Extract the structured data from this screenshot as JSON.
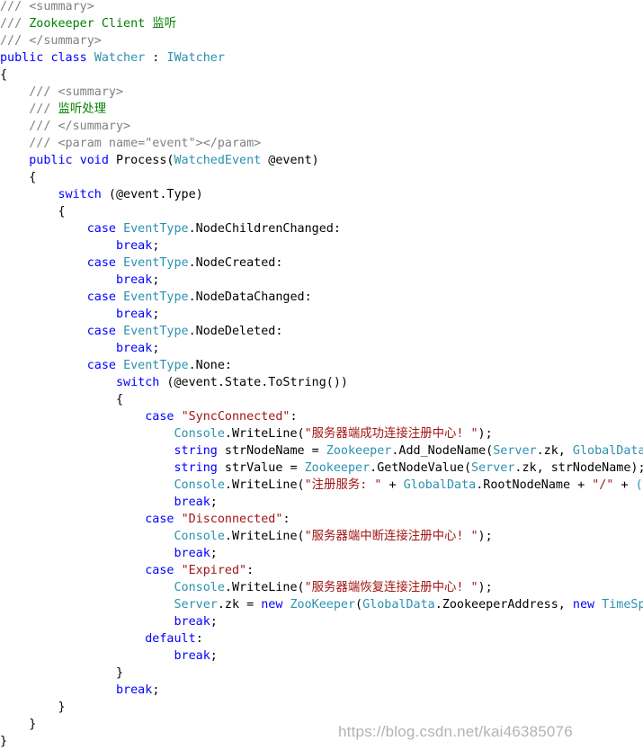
{
  "colors": {
    "plain": "#000000",
    "keyword": "#0000ff",
    "type": "#2b91af",
    "string": "#a31515",
    "comment": "#008000",
    "doc": "#808080",
    "background": "#ffffff"
  },
  "lines": [
    [
      [
        "doc",
        "/// <summary>"
      ]
    ],
    [
      [
        "doc",
        "/// "
      ],
      [
        "comment",
        "Zookeeper Client 监听"
      ]
    ],
    [
      [
        "doc",
        "/// </summary>"
      ]
    ],
    [
      [
        "keyword",
        "public"
      ],
      [
        "plain",
        " "
      ],
      [
        "keyword",
        "class"
      ],
      [
        "plain",
        " "
      ],
      [
        "type",
        "Watcher"
      ],
      [
        "plain",
        " : "
      ],
      [
        "type",
        "IWatcher"
      ]
    ],
    [
      [
        "plain",
        "{"
      ]
    ],
    [
      [
        "plain",
        "    "
      ],
      [
        "doc",
        "/// <summary>"
      ]
    ],
    [
      [
        "plain",
        "    "
      ],
      [
        "doc",
        "/// "
      ],
      [
        "comment",
        "监听处理"
      ]
    ],
    [
      [
        "plain",
        "    "
      ],
      [
        "doc",
        "/// </summary>"
      ]
    ],
    [
      [
        "plain",
        "    "
      ],
      [
        "doc",
        "/// <param name=\"event\"></param>"
      ]
    ],
    [
      [
        "plain",
        "    "
      ],
      [
        "keyword",
        "public"
      ],
      [
        "plain",
        " "
      ],
      [
        "keyword",
        "void"
      ],
      [
        "plain",
        " Process("
      ],
      [
        "type",
        "WatchedEvent"
      ],
      [
        "plain",
        " @event)"
      ]
    ],
    [
      [
        "plain",
        "    {"
      ]
    ],
    [
      [
        "plain",
        "        "
      ],
      [
        "keyword",
        "switch"
      ],
      [
        "plain",
        " (@event.Type)"
      ]
    ],
    [
      [
        "plain",
        "        {"
      ]
    ],
    [
      [
        "plain",
        "            "
      ],
      [
        "keyword",
        "case"
      ],
      [
        "plain",
        " "
      ],
      [
        "type",
        "EventType"
      ],
      [
        "plain",
        ".NodeChildrenChanged:"
      ]
    ],
    [
      [
        "plain",
        "                "
      ],
      [
        "keyword",
        "break"
      ],
      [
        "plain",
        ";"
      ]
    ],
    [
      [
        "plain",
        "            "
      ],
      [
        "keyword",
        "case"
      ],
      [
        "plain",
        " "
      ],
      [
        "type",
        "EventType"
      ],
      [
        "plain",
        ".NodeCreated:"
      ]
    ],
    [
      [
        "plain",
        "                "
      ],
      [
        "keyword",
        "break"
      ],
      [
        "plain",
        ";"
      ]
    ],
    [
      [
        "plain",
        "            "
      ],
      [
        "keyword",
        "case"
      ],
      [
        "plain",
        " "
      ],
      [
        "type",
        "EventType"
      ],
      [
        "plain",
        ".NodeDataChanged:"
      ]
    ],
    [
      [
        "plain",
        "                "
      ],
      [
        "keyword",
        "break"
      ],
      [
        "plain",
        ";"
      ]
    ],
    [
      [
        "plain",
        "            "
      ],
      [
        "keyword",
        "case"
      ],
      [
        "plain",
        " "
      ],
      [
        "type",
        "EventType"
      ],
      [
        "plain",
        ".NodeDeleted:"
      ]
    ],
    [
      [
        "plain",
        "                "
      ],
      [
        "keyword",
        "break"
      ],
      [
        "plain",
        ";"
      ]
    ],
    [
      [
        "plain",
        "            "
      ],
      [
        "keyword",
        "case"
      ],
      [
        "plain",
        " "
      ],
      [
        "type",
        "EventType"
      ],
      [
        "plain",
        ".None:"
      ]
    ],
    [
      [
        "plain",
        "                "
      ],
      [
        "keyword",
        "switch"
      ],
      [
        "plain",
        " (@event.State.ToString())"
      ]
    ],
    [
      [
        "plain",
        "                {"
      ]
    ],
    [
      [
        "plain",
        "                    "
      ],
      [
        "keyword",
        "case"
      ],
      [
        "plain",
        " "
      ],
      [
        "string",
        "\"SyncConnected\""
      ],
      [
        "plain",
        ":"
      ]
    ],
    [
      [
        "plain",
        "                        "
      ],
      [
        "type",
        "Console"
      ],
      [
        "plain",
        ".WriteLine("
      ],
      [
        "string",
        "\"服务器端成功连接注册中心! \""
      ],
      [
        "plain",
        ");"
      ]
    ],
    [
      [
        "plain",
        "                        "
      ],
      [
        "keyword",
        "string"
      ],
      [
        "plain",
        " strNodeName = "
      ],
      [
        "type",
        "Zookeeper"
      ],
      [
        "plain",
        ".Add_NodeName("
      ],
      [
        "type",
        "Server"
      ],
      [
        "plain",
        ".zk, "
      ],
      [
        "type",
        "GlobalData"
      ],
      [
        "plain",
        "."
      ]
    ],
    [
      [
        "plain",
        "                        "
      ],
      [
        "keyword",
        "string"
      ],
      [
        "plain",
        " strValue = "
      ],
      [
        "type",
        "Zookeeper"
      ],
      [
        "plain",
        ".GetNodeValue("
      ],
      [
        "type",
        "Server"
      ],
      [
        "plain",
        ".zk, strNodeName);"
      ]
    ],
    [
      [
        "plain",
        "                        "
      ],
      [
        "type",
        "Console"
      ],
      [
        "plain",
        ".WriteLine("
      ],
      [
        "string",
        "\"注册服务: \""
      ],
      [
        "plain",
        " + "
      ],
      [
        "type",
        "GlobalData"
      ],
      [
        "plain",
        ".RootNodeName + "
      ],
      [
        "string",
        "\"/\""
      ],
      [
        "plain",
        " + "
      ],
      [
        "type",
        "("
      ]
    ],
    [
      [
        "plain",
        "                        "
      ],
      [
        "keyword",
        "break"
      ],
      [
        "plain",
        ";"
      ]
    ],
    [
      [
        "plain",
        "                    "
      ],
      [
        "keyword",
        "case"
      ],
      [
        "plain",
        " "
      ],
      [
        "string",
        "\"Disconnected\""
      ],
      [
        "plain",
        ":"
      ]
    ],
    [
      [
        "plain",
        "                        "
      ],
      [
        "type",
        "Console"
      ],
      [
        "plain",
        ".WriteLine("
      ],
      [
        "string",
        "\"服务器端中断连接注册中心! \""
      ],
      [
        "plain",
        ");"
      ]
    ],
    [
      [
        "plain",
        "                        "
      ],
      [
        "keyword",
        "break"
      ],
      [
        "plain",
        ";"
      ]
    ],
    [
      [
        "plain",
        "                    "
      ],
      [
        "keyword",
        "case"
      ],
      [
        "plain",
        " "
      ],
      [
        "string",
        "\"Expired\""
      ],
      [
        "plain",
        ":"
      ]
    ],
    [
      [
        "plain",
        "                        "
      ],
      [
        "type",
        "Console"
      ],
      [
        "plain",
        ".WriteLine("
      ],
      [
        "string",
        "\"服务器端恢复连接注册中心! \""
      ],
      [
        "plain",
        ");"
      ]
    ],
    [
      [
        "plain",
        "                        "
      ],
      [
        "type",
        "Server"
      ],
      [
        "plain",
        ".zk = "
      ],
      [
        "keyword",
        "new"
      ],
      [
        "plain",
        " "
      ],
      [
        "type",
        "ZooKeeper"
      ],
      [
        "plain",
        "("
      ],
      [
        "type",
        "GlobalData"
      ],
      [
        "plain",
        ".ZookeeperAddress, "
      ],
      [
        "keyword",
        "new"
      ],
      [
        "plain",
        " "
      ],
      [
        "type",
        "TimeSp"
      ]
    ],
    [
      [
        "plain",
        "                        "
      ],
      [
        "keyword",
        "break"
      ],
      [
        "plain",
        ";"
      ]
    ],
    [
      [
        "plain",
        "                    "
      ],
      [
        "keyword",
        "default"
      ],
      [
        "plain",
        ":"
      ]
    ],
    [
      [
        "plain",
        "                        "
      ],
      [
        "keyword",
        "break"
      ],
      [
        "plain",
        ";"
      ]
    ],
    [
      [
        "plain",
        "                }"
      ]
    ],
    [
      [
        "plain",
        "                "
      ],
      [
        "keyword",
        "break"
      ],
      [
        "plain",
        ";"
      ]
    ],
    [
      [
        "plain",
        "        }"
      ]
    ],
    [
      [
        "plain",
        "    }"
      ]
    ],
    [
      [
        "plain",
        "}"
      ]
    ]
  ],
  "watermark": "https://blog.csdn.net/kai46385076"
}
